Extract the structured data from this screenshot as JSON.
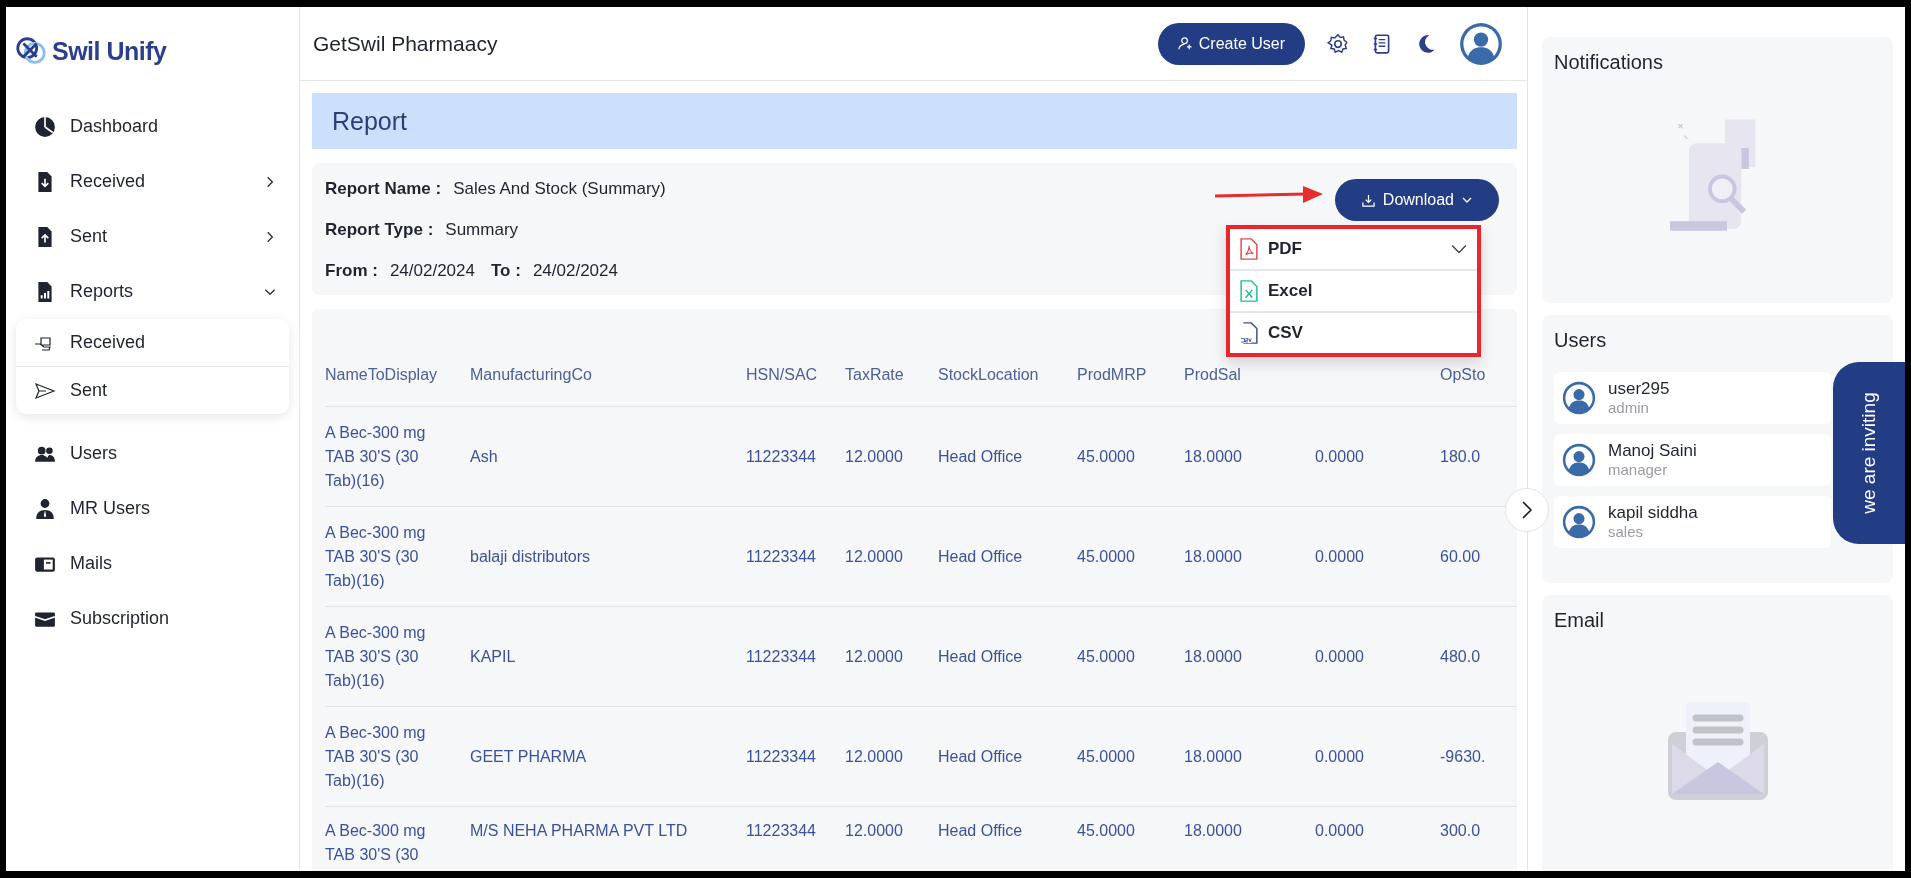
{
  "brand": {
    "name": "Swil Unify"
  },
  "sidebar": {
    "items": [
      {
        "label": "Dashboard",
        "kind": "dashboard"
      },
      {
        "label": "Received",
        "kind": "received",
        "expanded": false
      },
      {
        "label": "Sent",
        "kind": "sent",
        "expanded": false
      },
      {
        "label": "Reports",
        "kind": "reports",
        "expanded": true,
        "children": [
          {
            "label": "Received",
            "kind": "received"
          },
          {
            "label": "Sent",
            "kind": "sent"
          }
        ]
      },
      {
        "label": "Users",
        "kind": "users"
      },
      {
        "label": "MR Users",
        "kind": "mr"
      },
      {
        "label": "Mails",
        "kind": "mails"
      },
      {
        "label": "Subscription",
        "kind": "subscription"
      }
    ]
  },
  "header": {
    "title": "GetSwil Pharmaacy",
    "create_button": "Create User"
  },
  "page_title": "Report",
  "report_info": {
    "name_label": "Report Name :",
    "name": "Sales And Stock (Summary)",
    "type_label": "Report Type :",
    "type": "Summary",
    "from_label": "From :",
    "from": "24/02/2024",
    "to_label": "To :",
    "to": "24/02/2024"
  },
  "download": {
    "label": "Download",
    "expanded": true,
    "options": [
      {
        "label": "PDF",
        "kind": "pdf"
      },
      {
        "label": "Excel",
        "kind": "excel"
      },
      {
        "label": "CSV",
        "kind": "csv"
      }
    ]
  },
  "table": {
    "columns": [
      "NameToDisplay",
      "ManufacturingCo",
      "HSN/SAC",
      "TaxRate",
      "StockLocation",
      "ProdMRP",
      "ProdSal",
      null,
      "OpSto"
    ],
    "rows": [
      [
        "A Bec-300 mg TAB 30'S (30 Tab)(16)",
        "Ash",
        "11223344",
        "12.0000",
        "Head Office",
        "45.0000",
        "18.0000",
        "0.0000",
        "180.0"
      ],
      [
        "A Bec-300 mg TAB 30'S (30 Tab)(16)",
        "balaji distributors",
        "11223344",
        "12.0000",
        "Head Office",
        "45.0000",
        "18.0000",
        "0.0000",
        "60.00"
      ],
      [
        "A Bec-300 mg TAB 30'S (30 Tab)(16)",
        "KAPIL",
        "11223344",
        "12.0000",
        "Head Office",
        "45.0000",
        "18.0000",
        "0.0000",
        "480.0"
      ],
      [
        "A Bec-300 mg TAB 30'S (30 Tab)(16)",
        "GEET PHARMA",
        "11223344",
        "12.0000",
        "Head Office",
        "45.0000",
        "18.0000",
        "0.0000",
        "-9630."
      ],
      [
        "A Bec-300 mg TAB 30'S (30",
        "M/S NEHA PHARMA PVT LTD",
        "11223344",
        "12.0000",
        "Head Office",
        "45.0000",
        "18.0000",
        "0.0000",
        "300.0"
      ]
    ]
  },
  "notifications": {
    "title": "Notifications"
  },
  "users": {
    "title": "Users",
    "list": [
      {
        "name": "user295",
        "role": "admin"
      },
      {
        "name": "Manoj Saini",
        "role": "manager"
      },
      {
        "name": "kapil siddha",
        "role": "sales"
      }
    ]
  },
  "email": {
    "title": "Email"
  },
  "invite_tab": "we are inviting"
}
